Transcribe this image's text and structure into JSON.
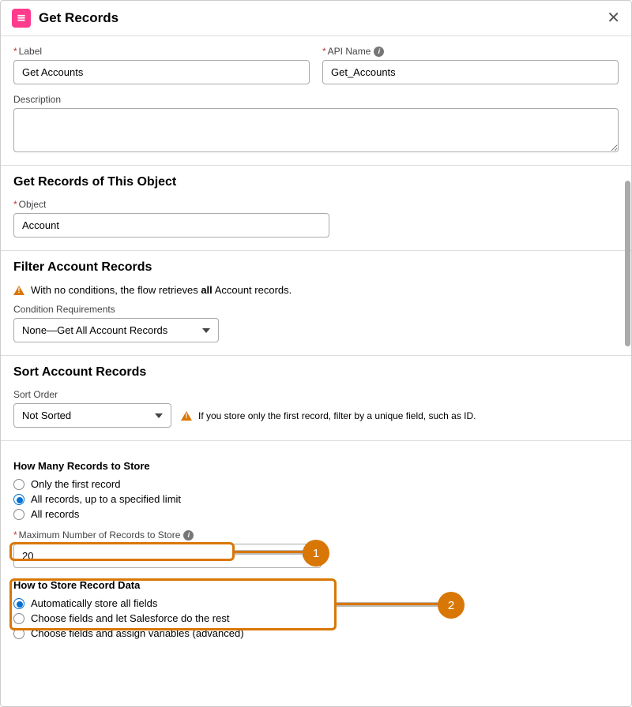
{
  "header": {
    "title": "Get Records"
  },
  "basic": {
    "label_label": "Label",
    "label_value": "Get Accounts",
    "api_label": "API Name",
    "api_value": "Get_Accounts",
    "desc_label": "Description",
    "desc_value": ""
  },
  "object_section": {
    "title": "Get Records of This Object",
    "object_label": "Object",
    "object_value": "Account"
  },
  "filter_section": {
    "title": "Filter Account Records",
    "warning_prefix": "With no conditions, the flow retrieves ",
    "warning_bold": "all",
    "warning_suffix": " Account records.",
    "cond_label": "Condition Requirements",
    "cond_value": "None—Get All Account Records"
  },
  "sort_section": {
    "title": "Sort Account Records",
    "sort_label": "Sort Order",
    "sort_value": "Not Sorted",
    "sort_warning": "If you store only the first record, filter by a unique field, such as ID."
  },
  "store_section": {
    "how_many_title": "How Many Records to Store",
    "opt1": "Only the first record",
    "opt2": "All records, up to a specified limit",
    "opt3": "All records",
    "max_label": "Maximum Number of Records to Store",
    "max_value": "20",
    "how_store_title": "How to Store Record Data",
    "s_opt1": "Automatically store all fields",
    "s_opt2": "Choose fields and let Salesforce do the rest",
    "s_opt3": "Choose fields and assign variables (advanced)"
  },
  "annotations": {
    "badge1": "1",
    "badge2": "2"
  }
}
